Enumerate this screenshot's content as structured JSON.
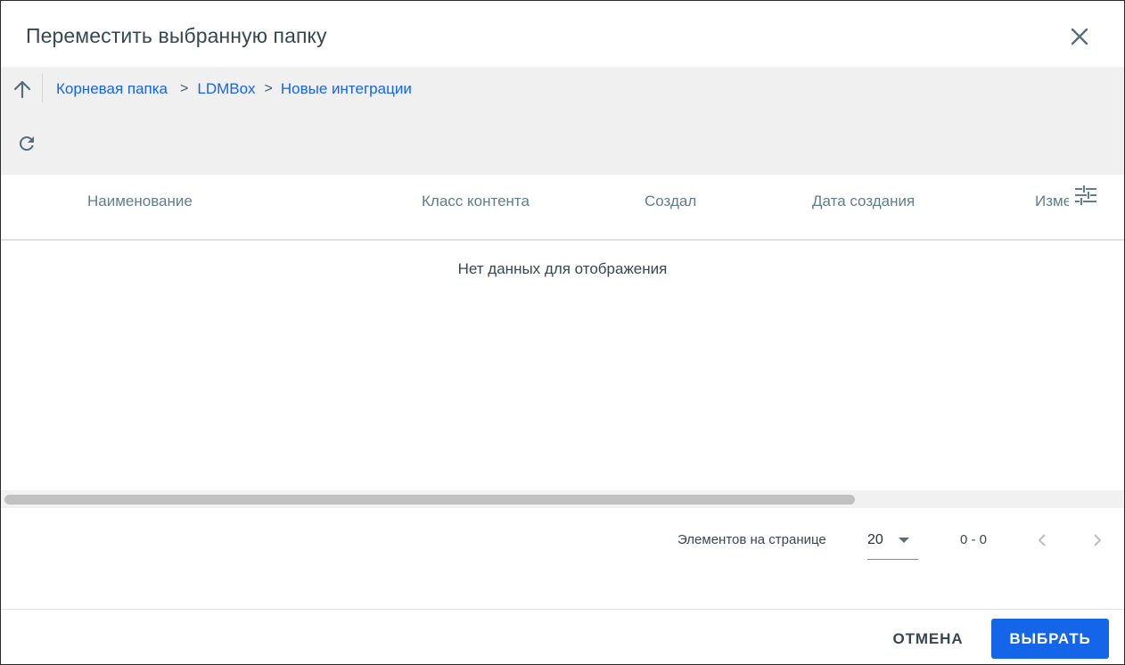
{
  "dialog": {
    "title": "Переместить выбранную папку"
  },
  "toolbar": {
    "up_icon": "arrow-up-icon",
    "refresh_icon": "refresh-icon",
    "breadcrumb": [
      {
        "label": "Корневая папка"
      },
      {
        "label": "LDMBox"
      },
      {
        "label": "Новые интеграции"
      }
    ],
    "breadcrumb_separator": ">"
  },
  "table": {
    "columns": [
      "Наименование",
      "Класс контента",
      "Создал",
      "Дата создания",
      "Изме"
    ],
    "empty_message": "Нет данных для отображения",
    "settings_icon": "column-settings-icon"
  },
  "paginator": {
    "items_per_page_label": "Элементов на странице",
    "items_per_page_value": "20",
    "range_label": "0 - 0"
  },
  "actions": {
    "cancel_label": "ОТМЕНА",
    "select_label": "ВЫБРАТЬ"
  },
  "colors": {
    "accent": "#1565e8",
    "toolbar_bg": "#f0f0f0",
    "header_text": "#607d8b"
  }
}
